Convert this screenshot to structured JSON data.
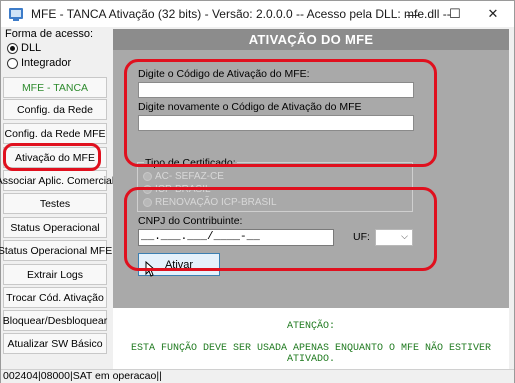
{
  "window": {
    "title": "MFE - TANCA Ativação (32 bits) - Versão: 2.0.0.0  --  Acesso pela DLL: mfe.dll  --",
    "minimize_glyph": "—",
    "maximize_glyph": "☐",
    "close_glyph": "✕"
  },
  "access": {
    "label": "Forma de acesso:",
    "options": [
      {
        "label": "DLL",
        "selected": true
      },
      {
        "label": "Integrador",
        "selected": false
      }
    ]
  },
  "nav": {
    "items": [
      "MFE - TANCA",
      "Config. da Rede",
      "Config. da Rede MFE",
      "Ativação do MFE",
      "Associar Aplic. Comercial",
      "Testes",
      "Status Operacional",
      "Status Operacional MFE",
      "Extrair Logs",
      "Trocar Cód. Ativação",
      "Bloquear/Desbloquear",
      "Atualizar SW Básico"
    ],
    "active_item": "Ativação do MFE"
  },
  "main": {
    "header": "ATIVAÇÃO DO MFE",
    "activation_code_label": "Digite o Código de Ativação do MFE:",
    "activation_code_value": "",
    "activation_code_confirm_label": "Digite novamente o Código de Ativação do MFE",
    "activation_code_confirm_value": "",
    "cert_type_label": "Tipo de Certificado:",
    "cert_options": [
      "AC- SEFAZ-CE",
      "ICP-BRASIL",
      "RENOVAÇÃO ICP-BRASIL"
    ],
    "cnpj_label": "CNPJ do Contribuinte:",
    "cnpj_value": "__.___.___/____-__",
    "uf_label": "UF:",
    "uf_value": "",
    "ativar_label": "Ativar",
    "attention_title": "ATENÇÃO:",
    "attention_text": "ESTA FUNÇÃO DEVE SER USADA APENAS ENQUANTO O MFE NÃO ESTIVER ATIVADO."
  },
  "statusbar": {
    "text": "002404|08000|SAT em operacao||"
  },
  "colors": {
    "header_bg": "#8c8c8c",
    "panel_bg": "#a9a9a9",
    "annotation_red": "#e0101e",
    "attention_green": "#1f7a1f",
    "nav_mfe_green": "#2e8b2e"
  }
}
